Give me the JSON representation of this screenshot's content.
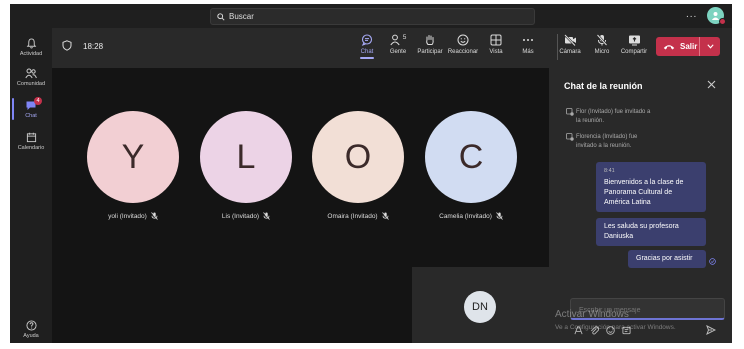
{
  "search": {
    "placeholder": "Buscar"
  },
  "topbar": {
    "more": "..."
  },
  "rail": {
    "items": [
      {
        "label": "Actividad",
        "icon": "bell-icon"
      },
      {
        "label": "Comunidad",
        "icon": "community-icon"
      },
      {
        "label": "Chat",
        "icon": "chat-icon",
        "badge": "4"
      },
      {
        "label": "Calendario",
        "icon": "calendar-icon"
      },
      {
        "label": "Ayuda",
        "icon": "help-icon"
      }
    ]
  },
  "meeting": {
    "timer": "18:28",
    "toolbar": {
      "chat": "Chat",
      "people": "Gente",
      "people_count": "5",
      "raise_hand": "Participar",
      "react": "Reaccionar",
      "view": "Vista",
      "more": "Más",
      "camera": "Cámara",
      "mic": "Micro",
      "share": "Compartir",
      "leave": "Salir"
    },
    "participants": [
      {
        "initial": "Y",
        "name": "yoli (Invitado)",
        "color": "#f2cfd3"
      },
      {
        "initial": "L",
        "name": "Lis (Invitado)",
        "color": "#ecd3e6"
      },
      {
        "initial": "O",
        "name": "Omaira (Invitado)",
        "color": "#f2dfd6"
      },
      {
        "initial": "C",
        "name": "Camelia (Invitado)",
        "color": "#d1dcf2"
      }
    ],
    "self_initials": "DN"
  },
  "chat": {
    "title": "Chat de la reunión",
    "system": [
      {
        "line1": "Flor (Invitado) fue invitado a",
        "line2": "la reunión."
      },
      {
        "line1": "Florencia (Invitado) fue",
        "line2": "invitado a la reunión."
      }
    ],
    "messages": [
      {
        "time": "8:41",
        "lines": [
          "Bienvenidos a la clase de",
          "Panorama Cultural de",
          "América Latina"
        ]
      },
      {
        "lines": [
          "Les saluda su profesora",
          "Daniuska"
        ]
      },
      {
        "lines": [
          "Gracias por asistir"
        ]
      }
    ],
    "compose_placeholder": "Escribir un mensaje"
  },
  "watermark": {
    "line1": "Activar Windows",
    "line2": "Ve a Configuración para activar Windows."
  }
}
